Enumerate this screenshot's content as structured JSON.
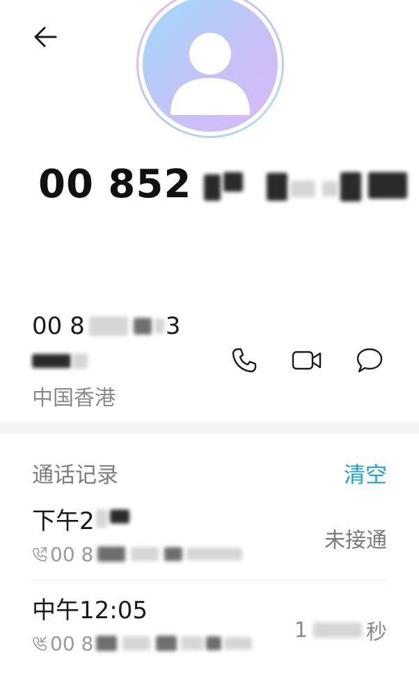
{
  "contact": {
    "name_visible": "00 852",
    "avatar_icon": "person-avatar-icon"
  },
  "number": {
    "line1_prefix": "00 8",
    "line1_suffix": "3"
  },
  "location": "中国香港",
  "actions": [
    {
      "icon": "phone-icon"
    },
    {
      "icon": "video-call-icon"
    },
    {
      "icon": "message-icon"
    }
  ],
  "call_log": {
    "title": "通话记录",
    "clear_label": "清空",
    "entries": [
      {
        "time_prefix": "下午2",
        "direction_icon": "outgoing-call-icon",
        "number_prefix": "00 8",
        "status": "未接通"
      },
      {
        "time": "中午12:05",
        "direction_icon": "incoming-call-icon",
        "number_prefix": "00 8",
        "duration_prefix": "1",
        "duration_suffix": "秒"
      }
    ]
  },
  "colors": {
    "accent": "#1aa0dc",
    "secondary_text": "#8a8a8a",
    "band": "#f4f4f4"
  }
}
